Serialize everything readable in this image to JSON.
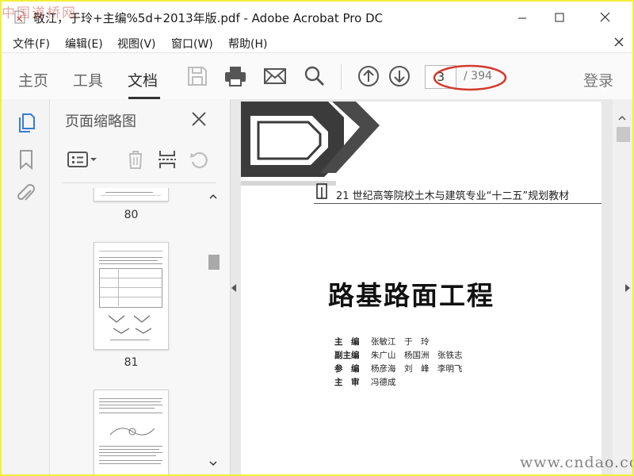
{
  "watermark": {
    "top_left": "中国道桥网",
    "bottom_right": "www.cndao.com"
  },
  "window": {
    "title": "敬江，于玲+主编%5d+2013年版.pdf - Adobe Acrobat Pro DC"
  },
  "menu": [
    "文件(F)",
    "编辑(E)",
    "视图(V)",
    "窗口(W)",
    "帮助(H)"
  ],
  "toolbar": {
    "tabs": [
      "主页",
      "工具",
      "文档"
    ],
    "active_tab": "文档",
    "icons": [
      "save-icon",
      "print-icon",
      "email-icon",
      "search-icon",
      "arrow-up-icon",
      "arrow-down-icon"
    ],
    "page_current": "3",
    "page_total": "/ 394",
    "login": "登录"
  },
  "thumbnail_panel": {
    "title": "页面缩略图",
    "pages": [
      "80",
      "81"
    ]
  },
  "document": {
    "series": "21 世纪高等院校土木与建筑专业“十二五”规划教材",
    "book_title": "路基路面工程",
    "credits": [
      {
        "role": "主　编",
        "names": "张敏江　于　玲"
      },
      {
        "role": "副主编",
        "names": "朱广山　杨国洲　张铁志"
      },
      {
        "role": "参　编",
        "names": "杨彦海　刘　峰　李明飞"
      },
      {
        "role": "主　审",
        "names": "冯德成"
      }
    ]
  },
  "colors": {
    "highlight": "#d33a2c",
    "page_frame": "#f2ee3a",
    "accent": "#3a7bd5"
  }
}
